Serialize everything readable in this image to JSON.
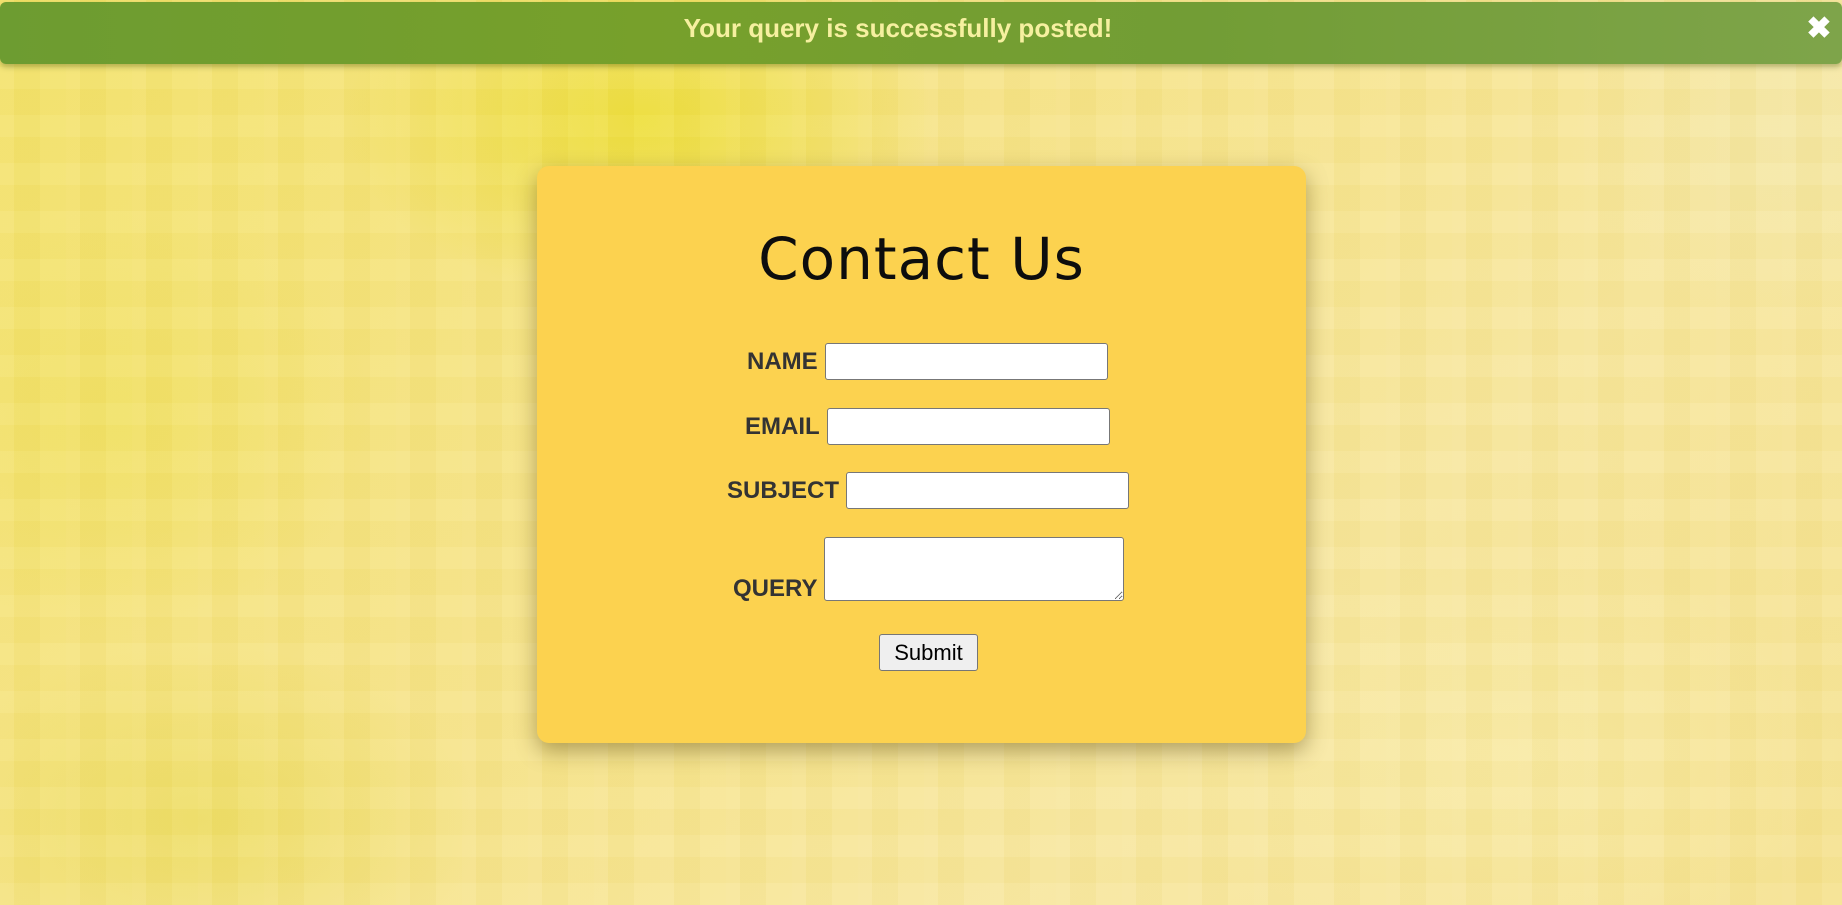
{
  "alert": {
    "message": "Your query is successfully posted!",
    "close_icon": "close-icon",
    "close_glyph": "✖"
  },
  "contact": {
    "title": "Contact Us",
    "fields": {
      "name": {
        "label": "NAME",
        "value": "",
        "placeholder": ""
      },
      "email": {
        "label": "EMAIL",
        "value": "",
        "placeholder": ""
      },
      "subject": {
        "label": "SUBJECT",
        "value": "",
        "placeholder": ""
      },
      "query": {
        "label": "QUERY",
        "value": "",
        "placeholder": ""
      }
    },
    "submit_label": "Submit"
  },
  "colors": {
    "alert_background": "#77a02b",
    "alert_text": "#f6f0a0",
    "card_background": "#fcd24f",
    "label_text": "#333333"
  }
}
